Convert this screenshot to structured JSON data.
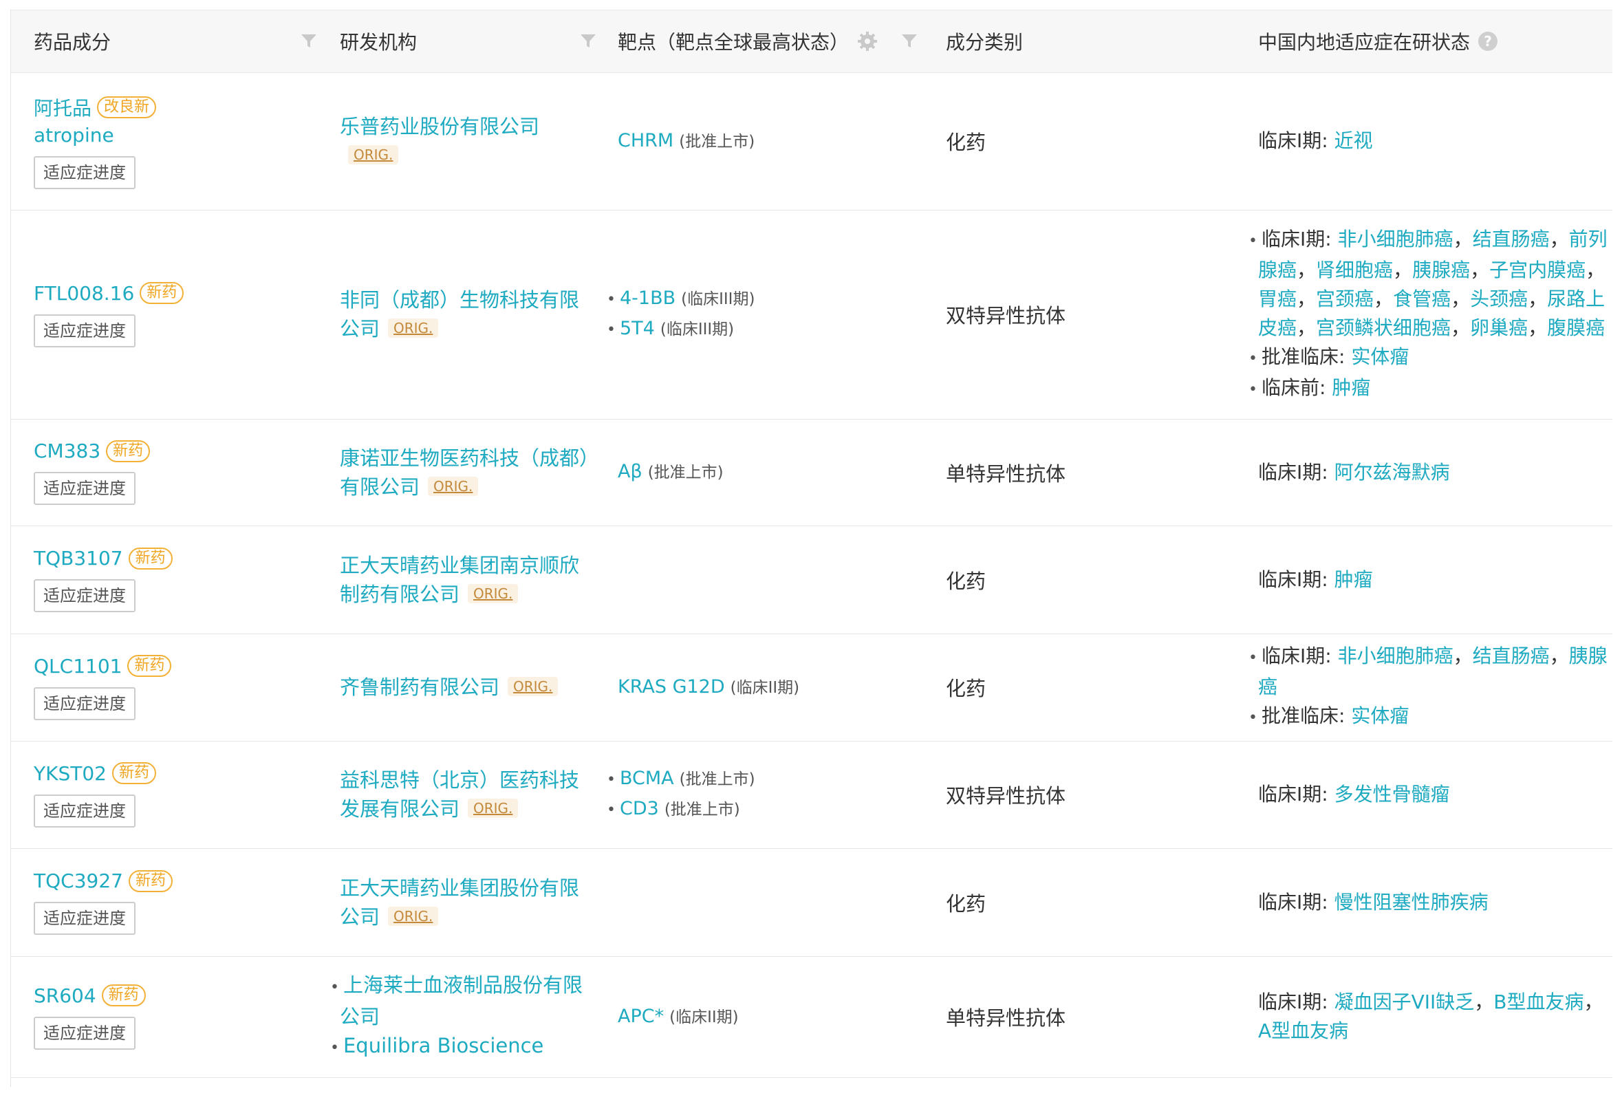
{
  "columns": {
    "drug": "药品成分",
    "org": "研发机构",
    "target": "靶点（靶点全球最高状态）",
    "category": "成分类别",
    "indication": "中国内地适应症在研状态"
  },
  "progress_button_label": "适应症进度",
  "orig_label": "ORIG.",
  "rows": [
    {
      "name": "阿托品",
      "tag": "改良新",
      "en": "atropine",
      "orgs": [
        "乐普药业股份有限公司"
      ],
      "targets": [
        {
          "name": "CHRM",
          "status": "(批准上市)"
        }
      ],
      "category": "化药",
      "indications": [
        {
          "phase": "临床I期: ",
          "items": [
            "近视"
          ]
        }
      ]
    },
    {
      "name": "FTL008.16",
      "tag": "新药",
      "orgs": [
        "非同（成都）生物科技有限公司"
      ],
      "targets": [
        {
          "name": "4-1BB",
          "status": "(临床III期)"
        },
        {
          "name": "5T4",
          "status": "(临床III期)"
        }
      ],
      "category": "双特异性抗体",
      "indications": [
        {
          "phase": "临床I期: ",
          "items": [
            "非小细胞肺癌",
            "结直肠癌",
            "前列腺癌",
            "肾细胞癌",
            "胰腺癌",
            "子宫内膜癌",
            "胃癌",
            "宫颈癌",
            "食管癌",
            "头颈癌",
            "尿路上皮癌",
            "宫颈鳞状细胞癌",
            "卵巢癌",
            "腹膜癌"
          ]
        },
        {
          "phase": "批准临床: ",
          "items": [
            "实体瘤"
          ]
        },
        {
          "phase": "临床前: ",
          "items": [
            "肿瘤"
          ]
        }
      ]
    },
    {
      "name": "CM383",
      "tag": "新药",
      "orgs": [
        "康诺亚生物医药科技（成都）有限公司"
      ],
      "targets": [
        {
          "name": "Aβ",
          "status": "(批准上市)"
        }
      ],
      "category": "单特异性抗体",
      "indications": [
        {
          "phase": "临床I期: ",
          "items": [
            "阿尔兹海默病"
          ]
        }
      ]
    },
    {
      "name": "TQB3107",
      "tag": "新药",
      "orgs": [
        "正大天晴药业集团南京顺欣制药有限公司"
      ],
      "targets": [],
      "category": "化药",
      "indications": [
        {
          "phase": "临床I期: ",
          "items": [
            "肿瘤"
          ]
        }
      ]
    },
    {
      "name": "QLC1101",
      "tag": "新药",
      "orgs": [
        "齐鲁制药有限公司"
      ],
      "targets": [
        {
          "name": "KRAS G12D",
          "status": "(临床II期)"
        }
      ],
      "category": "化药",
      "indications": [
        {
          "phase": "临床I期: ",
          "items": [
            "非小细胞肺癌",
            "结直肠癌",
            "胰腺癌"
          ]
        },
        {
          "phase": "批准临床: ",
          "items": [
            "实体瘤"
          ]
        }
      ]
    },
    {
      "name": "YKST02",
      "tag": "新药",
      "orgs": [
        "益科思特（北京）医药科技发展有限公司"
      ],
      "targets": [
        {
          "name": "BCMA",
          "status": "(批准上市)"
        },
        {
          "name": "CD3",
          "status": "(批准上市)"
        }
      ],
      "category": "双特异性抗体",
      "indications": [
        {
          "phase": "临床I期: ",
          "items": [
            "多发性骨髓瘤"
          ]
        }
      ]
    },
    {
      "name": "TQC3927",
      "tag": "新药",
      "orgs": [
        "正大天晴药业集团股份有限公司"
      ],
      "targets": [],
      "category": "化药",
      "indications": [
        {
          "phase": "临床I期: ",
          "items": [
            "慢性阻塞性肺疾病"
          ]
        }
      ]
    },
    {
      "name": "SR604",
      "tag": "新药",
      "orgs": [
        "上海莱士血液制品股份有限公司",
        "Equilibra Bioscience"
      ],
      "targets": [
        {
          "name": "APC*",
          "status": "(临床II期)"
        }
      ],
      "category": "单特异性抗体",
      "indications": [
        {
          "phase": "临床I期: ",
          "items": [
            "凝血因子VII缺乏",
            "B型血友病",
            "A型血友病"
          ]
        }
      ]
    }
  ]
}
